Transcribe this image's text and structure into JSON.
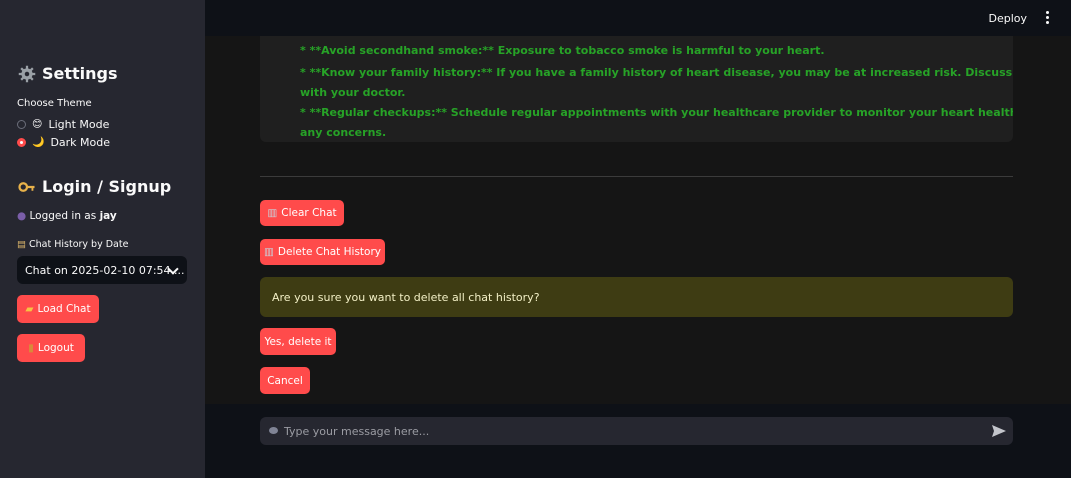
{
  "header": {
    "deploy_label": "Deploy"
  },
  "sidebar": {
    "settings_title": "Settings",
    "theme_label": "Choose Theme",
    "theme_options": [
      {
        "label": "Light Mode",
        "emoji": "😊",
        "selected": false
      },
      {
        "label": "Dark Mode",
        "emoji": "🌙",
        "selected": true
      }
    ],
    "login_title": "Login / Signup",
    "logged_in_prefix": "Logged in as ",
    "username": "jay",
    "history_label": "Chat History by Date",
    "history_selected": "Chat on 2025-02-10 07:54 ...",
    "load_chat_label": "Load Chat",
    "logout_label": "Logout"
  },
  "message": {
    "lines": [
      "* **Avoid secondhand smoke:** Exposure to tobacco smoke is harmful to your heart.",
      "* **Know your family history:** If you have a family history of heart disease, you may be at increased risk. Discuss your concerns",
      "with your doctor.",
      "* **Regular checkups:** Schedule regular appointments with your healthcare provider to monitor your heart health and discuss",
      "any concerns."
    ]
  },
  "actions": {
    "clear_chat_label": "Clear Chat",
    "delete_history_label": "Delete Chat History",
    "confirm_text": "Are you sure you want to delete all chat history?",
    "yes_label": "Yes, delete it",
    "cancel_label": "Cancel"
  },
  "input": {
    "placeholder": "Type your message here..."
  },
  "colors": {
    "accent": "#ff4b4b",
    "message_text": "#27a327",
    "warning_bg": "#3e3c13"
  }
}
